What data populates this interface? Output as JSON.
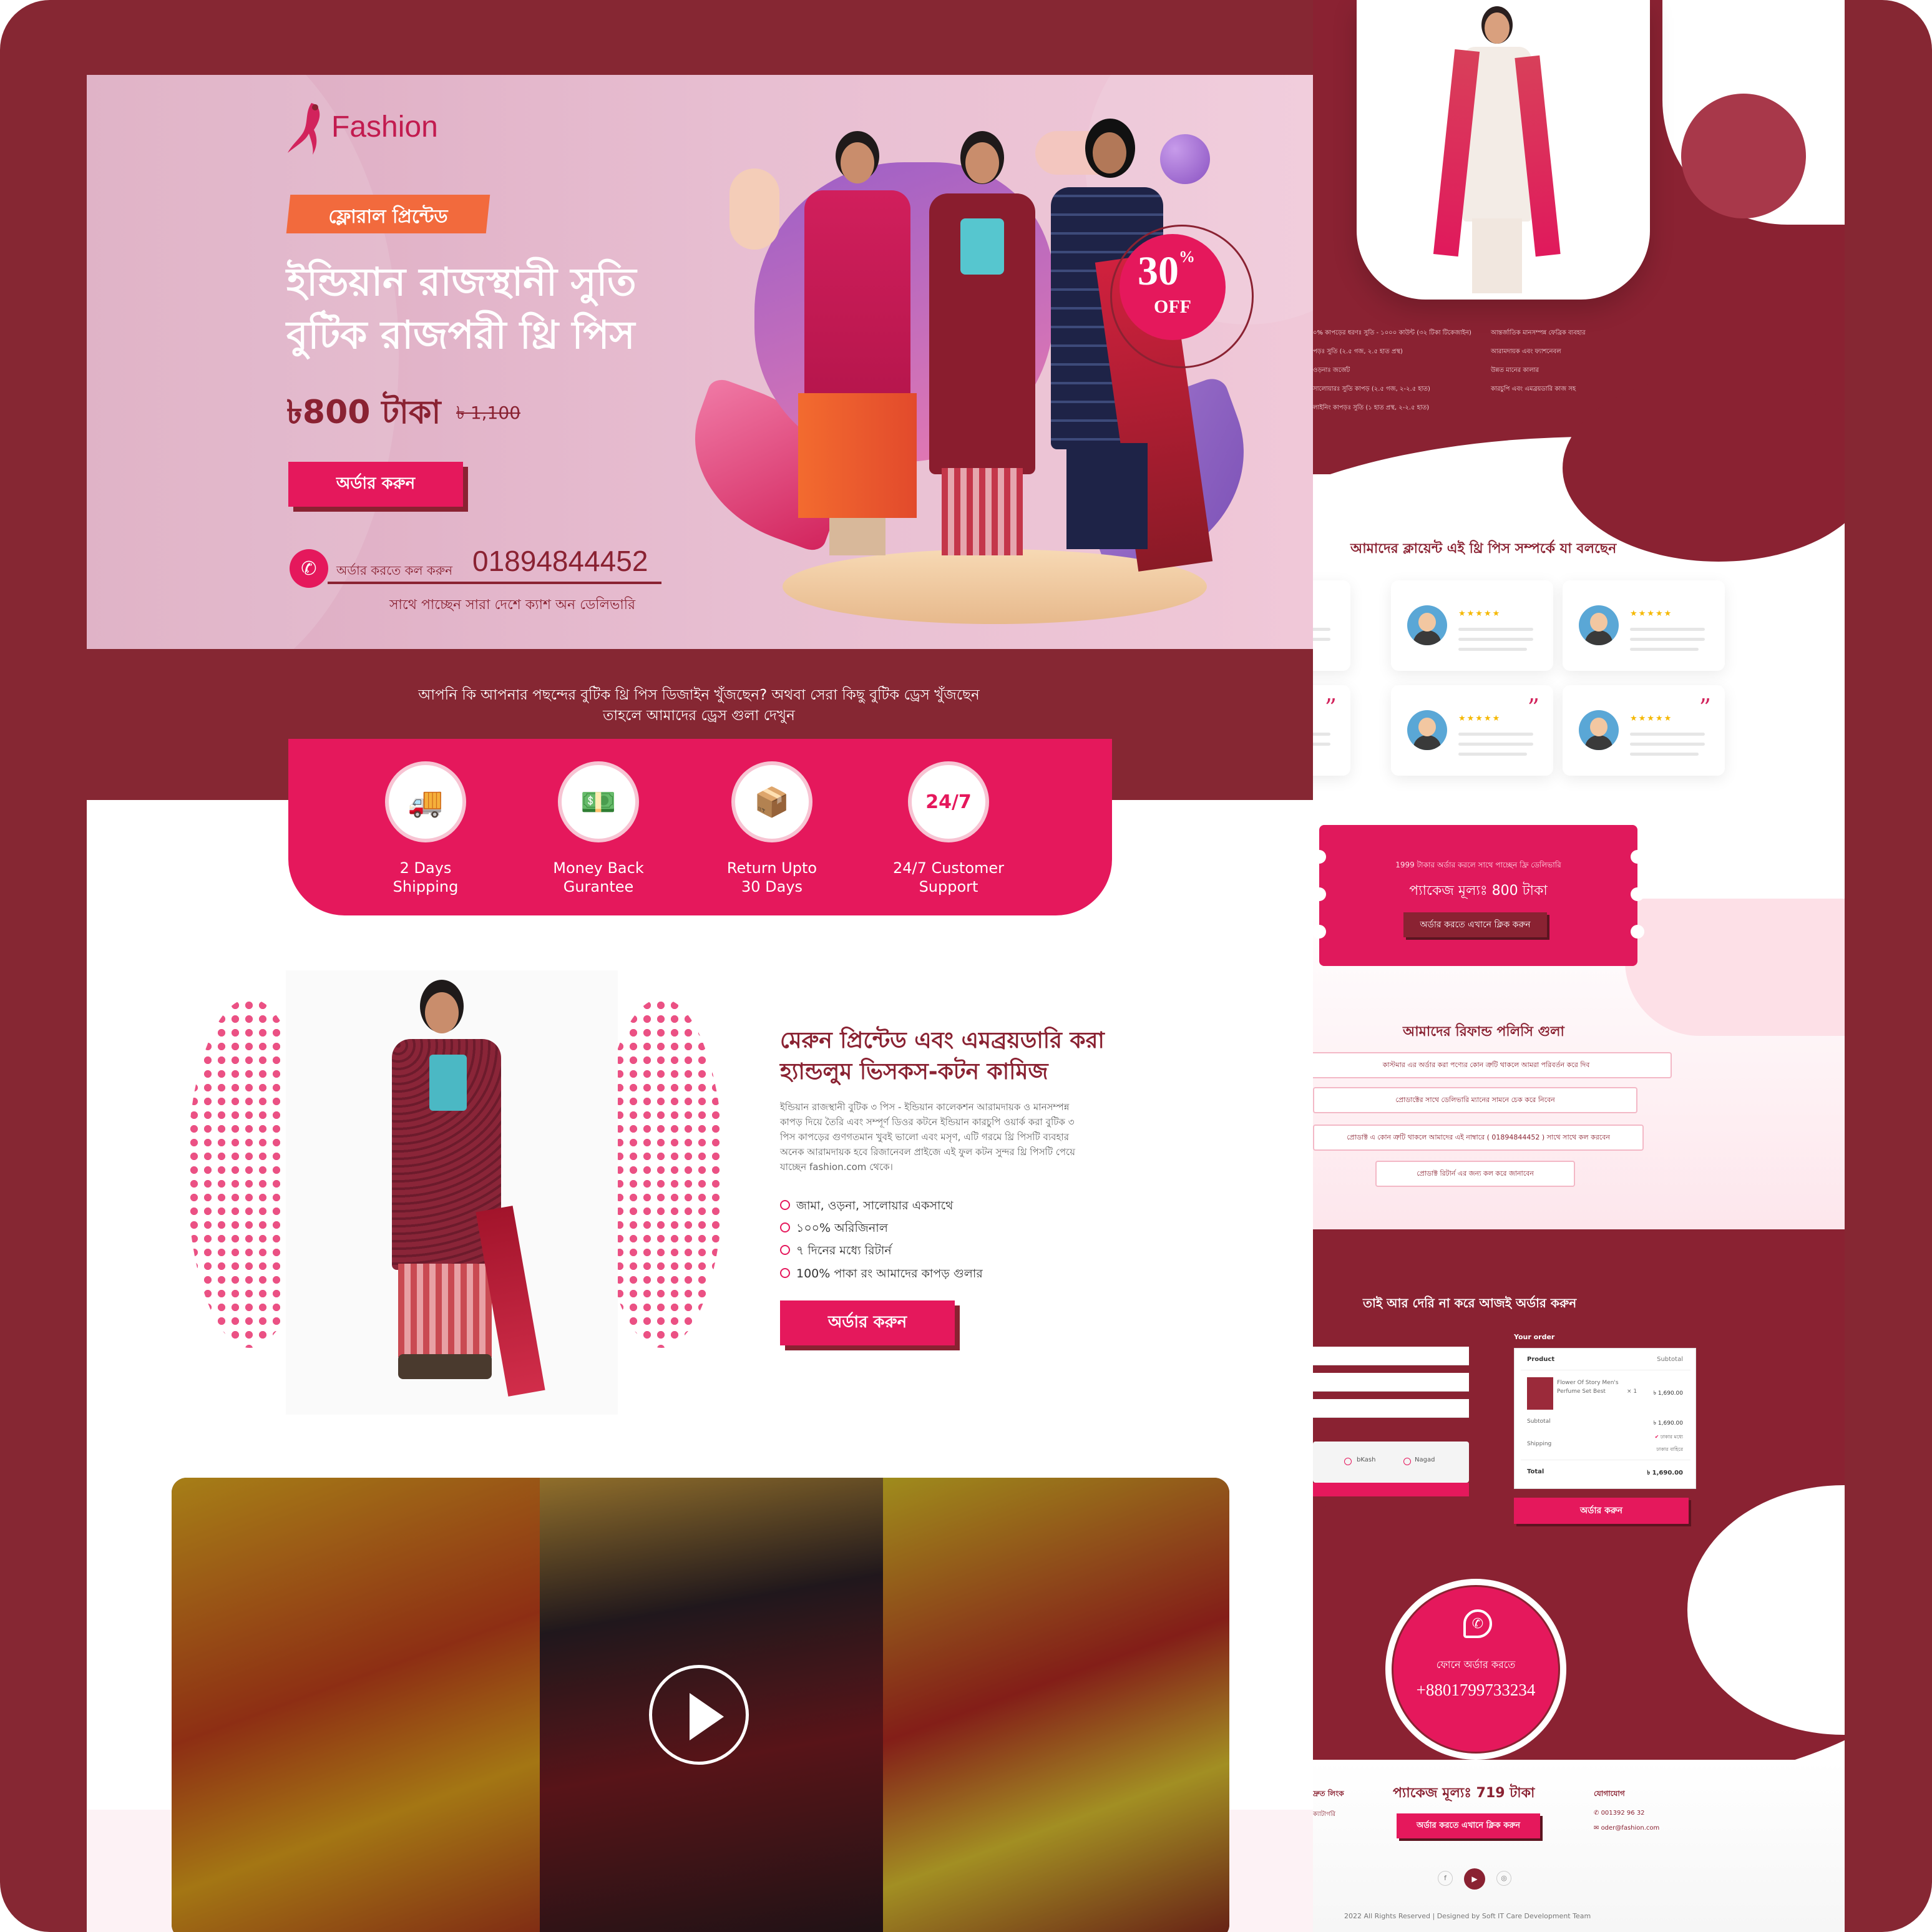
{
  "hero": {
    "logo_text": "Fashion",
    "tag": "ফ্লোরাল প্রিন্টেড",
    "title_line1": "ইন্ডিয়ান রাজস্থানী সুতি",
    "title_line2": "বুটিক রাজপরী থ্রি পিস",
    "price": "৳800 টাকা",
    "old_price": "৳ 1,100",
    "order_button": "অর্ডার করুন",
    "call_label": "অর্ডার করতে কল করুন",
    "phone": "01894844452",
    "delivery_note": "সাথে পাচ্ছেন সারা দেশে  ক্যাশ অন ডেলিভারি",
    "discount_number": "30",
    "discount_percent": "%",
    "discount_off": "OFF"
  },
  "intro": {
    "line1": "আপনি কি আপনার পছন্দের বুটিক থ্রি পিস ডিজাইন খুঁজছেন? অথবা সেরা কিছু বুটিক ড্রেস খুঁজছেন",
    "line2": "তাহলে আমাদের ড্রেস গুলা দেখুন"
  },
  "features": [
    {
      "icon": "delivery-truck-icon",
      "label": "2 Days\nShipping"
    },
    {
      "icon": "money-back-icon",
      "label": "Money Back\nGurantee"
    },
    {
      "icon": "return-box-icon",
      "label": "Return Upto\n30 Days"
    },
    {
      "icon": "support-24-7-icon",
      "label": "24/7 Customer\nSupport"
    }
  ],
  "product": {
    "title_line1": "মেরুন প্রিন্টেড এবং এমব্রয়ডারি করা",
    "title_line2": "হ্যান্ডলুম ভিসকস-কটন কামিজ",
    "desc_line1": "ইন্ডিয়ান রাজস্থানী বুটিক ৩ পিস - ইন্ডিয়ান কালেকশন আরামদায়ক ও মানসম্পন্ন",
    "desc_line2": "কাপড় দিয়ে তৈরি এবং সম্পূর্ণ ডিওর কটনে ইন্ডিয়ান কারচুপি ওয়ার্ক করা বুটিক ৩",
    "desc_line3": "পিস কাপড়ের গুণগতমান খুবই ভালো এবং মসৃণ, এটি গরমে থ্রি পিসটি ব্যবহার",
    "desc_line4": "অনেক আরামদায়ক হবে রিজানেবল প্রাইজে এই ফুল কটন সুন্দর থ্রি পিসটি পেয়ে",
    "desc_line5": "যাচ্ছেন fashion.com থেকে।",
    "checks": [
      "জামা, ওড়না, সালোয়ার একসাথে",
      "১০০% অরিজিনাল",
      "৭ দিনের মধ্যে রিটার্ন",
      "100% পাকা রং আমাদের কাপড় গুলার"
    ],
    "order_button": "অর্ডার করুন"
  },
  "right": {
    "specs_left": [
      "০% কাপড়ের ধরণঃ সুতি - ১০০০ কাউন্ট (৩২ টিকা টিকেজাইন)",
      "পড়ঃ সুতি (২.৫ গজ, ২.৫ হাত প্রস্থ)",
      "ওড়নাঃ জর্জেট",
      "সালোয়ারঃ সুতি কাপড় (২.৫ গজ, ২-২.৫ হাত)",
      "লাইনিং কাপড়ঃ সুতি (১ হাত প্রস্থ, ২-২.৫ হাত)"
    ],
    "specs_right": [
      "আন্তর্জাতিক মানসম্পন্ন ফেব্রিক ব্যবহার",
      "আরামদায়ক এবং ফ্যাশনেবল",
      "উন্নত মানের কালার",
      "কারচুপি এবং এমব্রয়ডারি কাজ সহ"
    ],
    "reviews_title": "আমাদের ক্লায়েন্ট এই থ্রি পিস সম্পর্কে যা বলছেন",
    "stars": "★★★★★",
    "coupon_note": "1999 টাকার অর্ডার করলে সাথে পাচ্ছেন ফ্রি ডেলিভারি",
    "coupon_price": "প্যাকেজ মূল্যঃ  800 টাকা",
    "coupon_button": "অর্ডার করতে এখানে ক্লিক করুন",
    "policy_title": "আমাদের রিফান্ড পলিসি গুলা",
    "policies": [
      "কাস্টমার এর অর্ডার করা পণ্যের কোন ত্রুটি থাকলে আমরা পরিবর্তন করে দিব",
      "প্রোডাক্টের সাথে ডেলিভারি ম্যানের সামনে চেক করে নিবেন",
      "প্রোডাক্ট এ কোন ত্রুটি থাকলে আমাদের এই নাম্বারে ( 01894844452 ) সাথে সাথে কল করবেন",
      "প্রোডাক্ট রিটার্ন এর জন্য কল করে জানাবেন"
    ],
    "order_title": "তাই আর দেরি না করে আজই অর্ডার করুন",
    "your_order": "Your order",
    "col_product": "Product",
    "col_subtotal": "Subtotal",
    "item_name_1": "Flower Of Story Men's",
    "item_name_2": "Perfume Set Best",
    "item_qty": "× 1",
    "item_price": "৳ 1,690.00",
    "subtotal_label": "Subtotal",
    "subtotal_value": "৳ 1,690.00",
    "shipping_label": "Shipping",
    "shipping_opt1": "ঢাকার মধ্যে",
    "shipping_opt2": "ঢাকার বাহিরে",
    "total_label": "Total",
    "total_value": "৳ 1,690.00",
    "pay1": "bKash",
    "pay2": "Nagad",
    "place_order": "অর্ডার করুন",
    "call_text": "ফোনে অর্ডার করতে",
    "call_number": "+8801799733234",
    "footer_link_col": "দ্রুত লিংক",
    "footer_link_sub": "ক্যাটাগরি",
    "footer_price": "প্যাকেজ মূল্যঃ  719 টাকা",
    "footer_button": "অর্ডার করতে এখানে ক্লিক করুন",
    "contact_title": "যোগাযোগ",
    "contact_phone": "001392 96 32",
    "contact_email": "oder@fashion.com",
    "copyright": "2022 All Rights Reserved | Designed by Soft IT Care Development Team"
  },
  "colors": {
    "brand": "#e5185c",
    "maroon": "#862733",
    "accent_orange": "#f26a3d"
  }
}
